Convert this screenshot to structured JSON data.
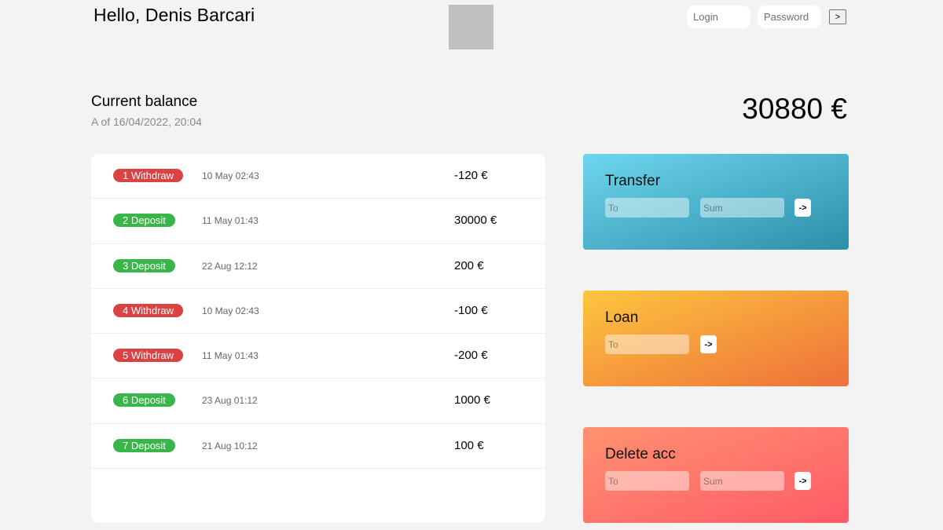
{
  "header": {
    "greeting": "Hello, Denis Barcari",
    "login_placeholder": "Login",
    "password_placeholder": "Password",
    "login_button": ">"
  },
  "balance": {
    "label": "Current balance",
    "date": "A of 16/04/2022, 20:04",
    "value": "30880 €"
  },
  "movements": [
    {
      "type": "1 Withdraw",
      "kind": "withdraw",
      "date": "10 May 02:43",
      "value": "-120 €"
    },
    {
      "type": "2 Deposit",
      "kind": "deposit",
      "date": "11 May 01:43",
      "value": "30000 €"
    },
    {
      "type": "3 Deposit",
      "kind": "deposit",
      "date": "22 Aug 12:12",
      "value": "200 €"
    },
    {
      "type": "4 Withdraw",
      "kind": "withdraw",
      "date": "10 May 02:43",
      "value": "-100 €"
    },
    {
      "type": "5 Withdraw",
      "kind": "withdraw",
      "date": "11 May 01:43",
      "value": "-200 €"
    },
    {
      "type": "6 Deposit",
      "kind": "deposit",
      "date": "23 Aug 01:12",
      "value": "1000 €"
    },
    {
      "type": "7 Deposit",
      "kind": "deposit",
      "date": "21 Aug 10:12",
      "value": "100 €"
    }
  ],
  "operations": {
    "transfer": {
      "title": "Transfer",
      "to_placeholder": "To",
      "sum_placeholder": "Sum",
      "button": "->"
    },
    "loan": {
      "title": "Loan",
      "to_placeholder": "To",
      "button": "->"
    },
    "close": {
      "title": "Delete acc",
      "to_placeholder": "To",
      "sum_placeholder": "Sum",
      "button": "->"
    }
  },
  "colors": {
    "deposit": "#39b54a",
    "withdraw": "#d94343",
    "background": "#f3f3f3"
  }
}
